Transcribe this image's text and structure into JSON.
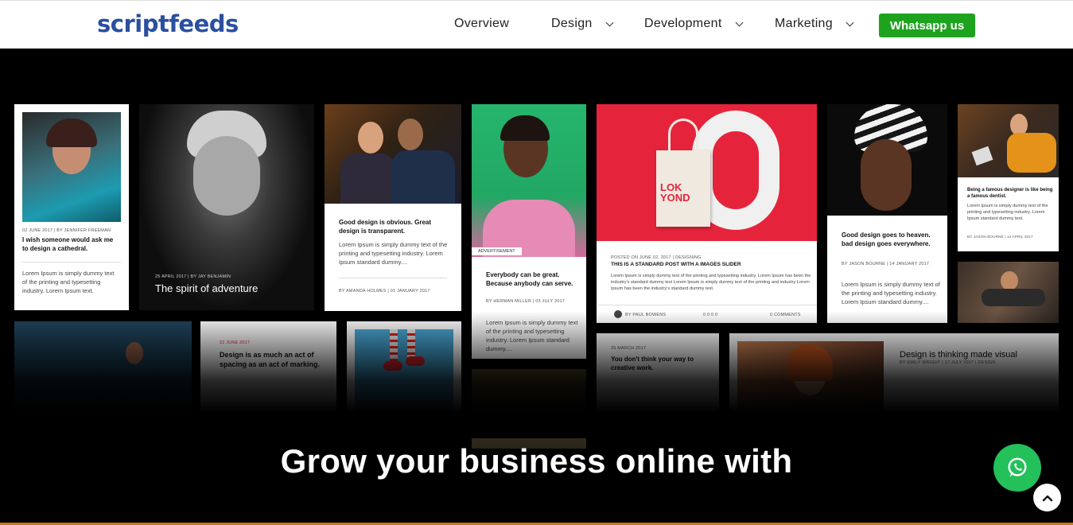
{
  "brand": {
    "logo": "scriptfeeds"
  },
  "nav": {
    "overview": "Overview",
    "design": "Design",
    "development": "Development",
    "marketing": "Marketing",
    "whatsapp_button": "Whatsapp us"
  },
  "cards": {
    "c1": {
      "meta": "02 JUNE 2017 | BY JENNIFER FREEMAN",
      "title": "I wish someone would ask me to design a cathedral.",
      "body": "Lorem Ipsum is simply dummy text of the printing and typesetting industry. Lorem Ipsum text."
    },
    "c2": {
      "meta": "25 APRIL 2017 | BY JAY BENJAMIN",
      "title": "The spirit of adventure"
    },
    "c3": {
      "title": "Good design is obvious. Great design is transparent.",
      "body": "Lorem Ipsum is simply dummy text of the printing and typesetting industry. Lorem Ipsum standard dummy....",
      "meta": "BY AMANDA HOLMES | 01 JANUARY 2017"
    },
    "c4": {
      "badge": "ADVERTISEMENT",
      "title": "Everybody can be great. Because anybody can serve.",
      "meta": "BY HERMAN MILLER | 03 JULY 2017",
      "body": "Lorem Ipsum is simply dummy text of the printing and typesetting industry. Lorem Ipsum standard dummy...."
    },
    "c5": {
      "bag_text": "LOK YOND",
      "meta": "POSTED ON JUNE 02, 2017 | DESIGNING",
      "title": "THIS IS A STANDARD POST WITH A IMAGES SLIDER",
      "body": "Lorem Ipsum is simply dummy text of the printing and typesetting industry. Lorem Ipsum has been the industry's standard dummy text Lorem Ipsum is simply dummy text of the printing and industry Lorem Ipsum has been the industry's standard dummy text.",
      "author": "BY PAUL BOWENS",
      "f2": "0 0 0 0",
      "f3": "0 COMMENTS"
    },
    "c6": {
      "title": "Good design goes to heaven. bad design goes everywhere.",
      "meta": "BY JASON BOURNE | 14 JANUARY 2017",
      "body": "Lorem Ipsum is simply dummy text of the printing and typesetting industry. Lorem Ipsum standard dummy...."
    },
    "c7": {
      "title": "Being a famous designer is like being a famous dentist.",
      "body": "Lorem Ipsum is simply dummy text of the printing and typesetting industry. Lorem Ipsum standard dummy text.",
      "meta": "BY JASON BOURNE | 14 APRIL 2017"
    },
    "c9": {
      "date": "22 JUNE 2017",
      "title": "Design is as much an act of spacing as an act of marking."
    },
    "c11": {
      "date": "25 MARCH 2017",
      "title": "You don't think your way to creative work."
    },
    "c12": {
      "title": "Design is thinking made visual",
      "meta": "BY EMILY WRIGHT | 17 JULY 2017 | DESIGN"
    }
  },
  "hero": {
    "headline": "Grow your business online with"
  },
  "colors": {
    "brand": "#2a4fa0",
    "whatsapp": "#1ea31e",
    "whatsapp_float": "#24c05a",
    "accent_red": "#e5243b"
  },
  "icons": {
    "chevron": "chevron-down-icon",
    "whatsapp": "whatsapp-icon",
    "arrow_up": "chevron-up-icon"
  }
}
